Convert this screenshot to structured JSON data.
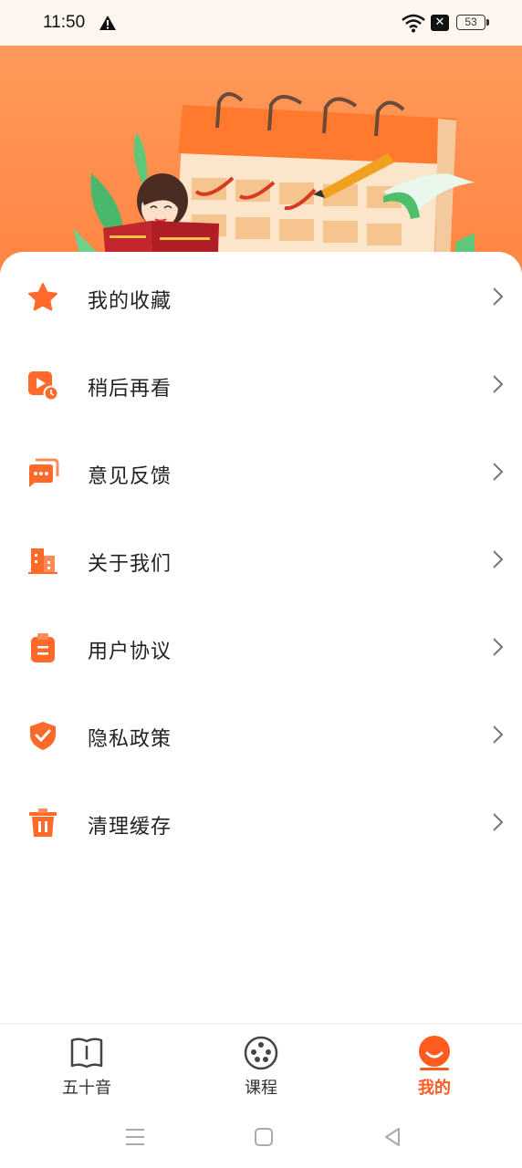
{
  "status_bar": {
    "time": "11:50",
    "battery": "53",
    "icons": [
      "warning-icon",
      "wifi-icon",
      "no-sim-icon",
      "battery-icon"
    ]
  },
  "colors": {
    "accent": "#ff5b1f",
    "hero_top": "#ff9a5a",
    "hero_bottom": "#ff8442",
    "icon_orange": "#ff6a2b"
  },
  "menu": [
    {
      "label": "我的收藏",
      "icon": "star-icon"
    },
    {
      "label": "稍后再看",
      "icon": "watch-later-icon"
    },
    {
      "label": "意见反馈",
      "icon": "feedback-icon"
    },
    {
      "label": "关于我们",
      "icon": "building-icon"
    },
    {
      "label": "用户协议",
      "icon": "clipboard-icon"
    },
    {
      "label": "隐私政策",
      "icon": "shield-check-icon"
    },
    {
      "label": "清理缓存",
      "icon": "trash-icon"
    }
  ],
  "bottom_nav": {
    "items": [
      {
        "label": "五十音",
        "icon": "book-icon",
        "active": false
      },
      {
        "label": "课程",
        "icon": "film-reel-icon",
        "active": false
      },
      {
        "label": "我的",
        "icon": "smile-face-icon",
        "active": true
      }
    ]
  },
  "system_nav": [
    "menu-icon",
    "home-icon",
    "back-icon"
  ]
}
